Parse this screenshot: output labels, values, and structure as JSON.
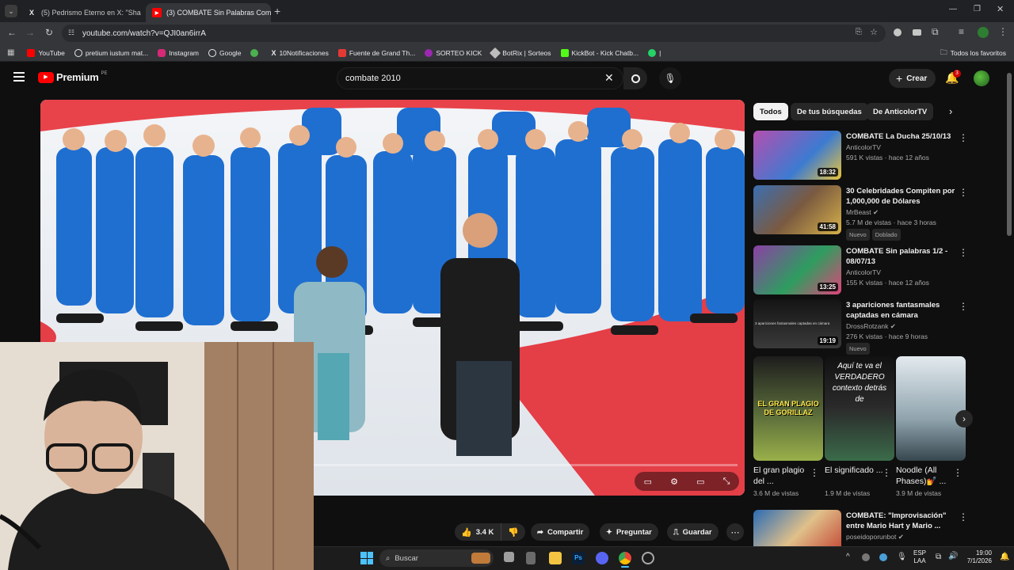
{
  "browser": {
    "tabs": [
      {
        "title": "(5) Pedrismo Eterno en X: \"Sha",
        "icon": "x-logo-icon"
      },
      {
        "title": "(3) COMBATE Sin Palabras Com",
        "icon": "youtube-icon"
      }
    ],
    "url": "youtube.com/watch?v=QJI0an6irrA",
    "bookmarks": [
      {
        "label": "YouTube",
        "color": "#ff0000"
      },
      {
        "label": "pretium iustum mat...",
        "color": "#e8eaed"
      },
      {
        "label": "Instagram",
        "color": "#d62976"
      },
      {
        "label": "Google",
        "color": "#e8eaed"
      },
      {
        "label": "",
        "color": "#4caf50"
      },
      {
        "label": "10Notificaciones",
        "color": "#e8eaed"
      },
      {
        "label": "Fuente de Grand Th...",
        "color": "#e53935"
      },
      {
        "label": "SORTEO KICK",
        "color": "#9c27b0"
      },
      {
        "label": "BotRix | Sorteos",
        "color": "#bdbdbd"
      },
      {
        "label": "KickBot - Kick Chatb...",
        "color": "#53fc18"
      },
      {
        "label": "|",
        "color": "#25d366"
      }
    ],
    "all_bookmarks": "Todos los favoritos"
  },
  "youtube": {
    "logo_text": "Premium",
    "logo_region": "PE",
    "search_query": "combate 2010",
    "create_label": "Crear",
    "notifications_count": "3"
  },
  "actions": {
    "likes": "3.4 K",
    "share": "Compartir",
    "ask": "Preguntar",
    "save": "Guardar"
  },
  "chips": [
    "Todos",
    "De tus búsquedas",
    "De AnticolorTV"
  ],
  "recommendations": [
    {
      "title": "COMBATE La Ducha 25/10/13",
      "channel": "AnticolorTV",
      "views": "591 K vistas · hace 12 años",
      "duration": "18:32",
      "badges": [],
      "color1": "#b44fb0",
      "color2": "#3c7bd1"
    },
    {
      "title": "30 Celebridades Compiten por 1,000,000 de Dólares",
      "channel": "MrBeast",
      "views": "5.7 M de vistas · hace 3 horas",
      "duration": "41:58",
      "badges": [
        "Nuevo",
        "Doblado"
      ],
      "color1": "#3b6fb2",
      "color2": "#d7b24a"
    },
    {
      "title": "COMBATE Sin palabras 1/2 - 08/07/13",
      "channel": "AnticolorTV",
      "views": "155 K vistas · hace 12 años",
      "duration": "13:25",
      "badges": [],
      "color1": "#8c3fa6",
      "color2": "#2e9d5f"
    },
    {
      "title": "3 apariciones fantasmales captadas en cámara",
      "channel": "DrossRotzank",
      "views": "276 K vistas · hace 9 horas",
      "duration": "19:19",
      "badges": [
        "Nuevo"
      ],
      "color1": "#202020",
      "color2": "#5a5a5a",
      "thumb_text": "3 apariciones fantasmales captadas en cámara"
    },
    {
      "title": "COMBATE: \"Improvisación\" entre Mario Hart y Mario ...",
      "channel": "poseidoporunbot",
      "views": "",
      "duration": "",
      "badges": [],
      "color1": "#2a6bb5",
      "color2": "#c0392b"
    }
  ],
  "shorts": [
    {
      "title": "El gran plagio del ...",
      "views": "3.6 M de vistas",
      "overlay": "EL GRAN PLAGIO DE GORILLAZ",
      "color1": "#3a4a2a",
      "color2": "#9ab04a"
    },
    {
      "title": "El significado ...",
      "views": "1.9 M de vistas",
      "overlay": "Aquí te va el VERDADERO contexto detrás de",
      "color1": "#1c1c1c",
      "color2": "#3b6b4a"
    },
    {
      "title": "Noodle (All Phases)💅 ...",
      "views": "3.9 M de vistas",
      "overlay": "",
      "color1": "#cfd8dc",
      "color2": "#607d8b"
    }
  ],
  "taskbar": {
    "search": "Buscar",
    "lang1": "ESP",
    "lang2": "LAA",
    "time": "19:00",
    "date": "7/1/2026"
  }
}
